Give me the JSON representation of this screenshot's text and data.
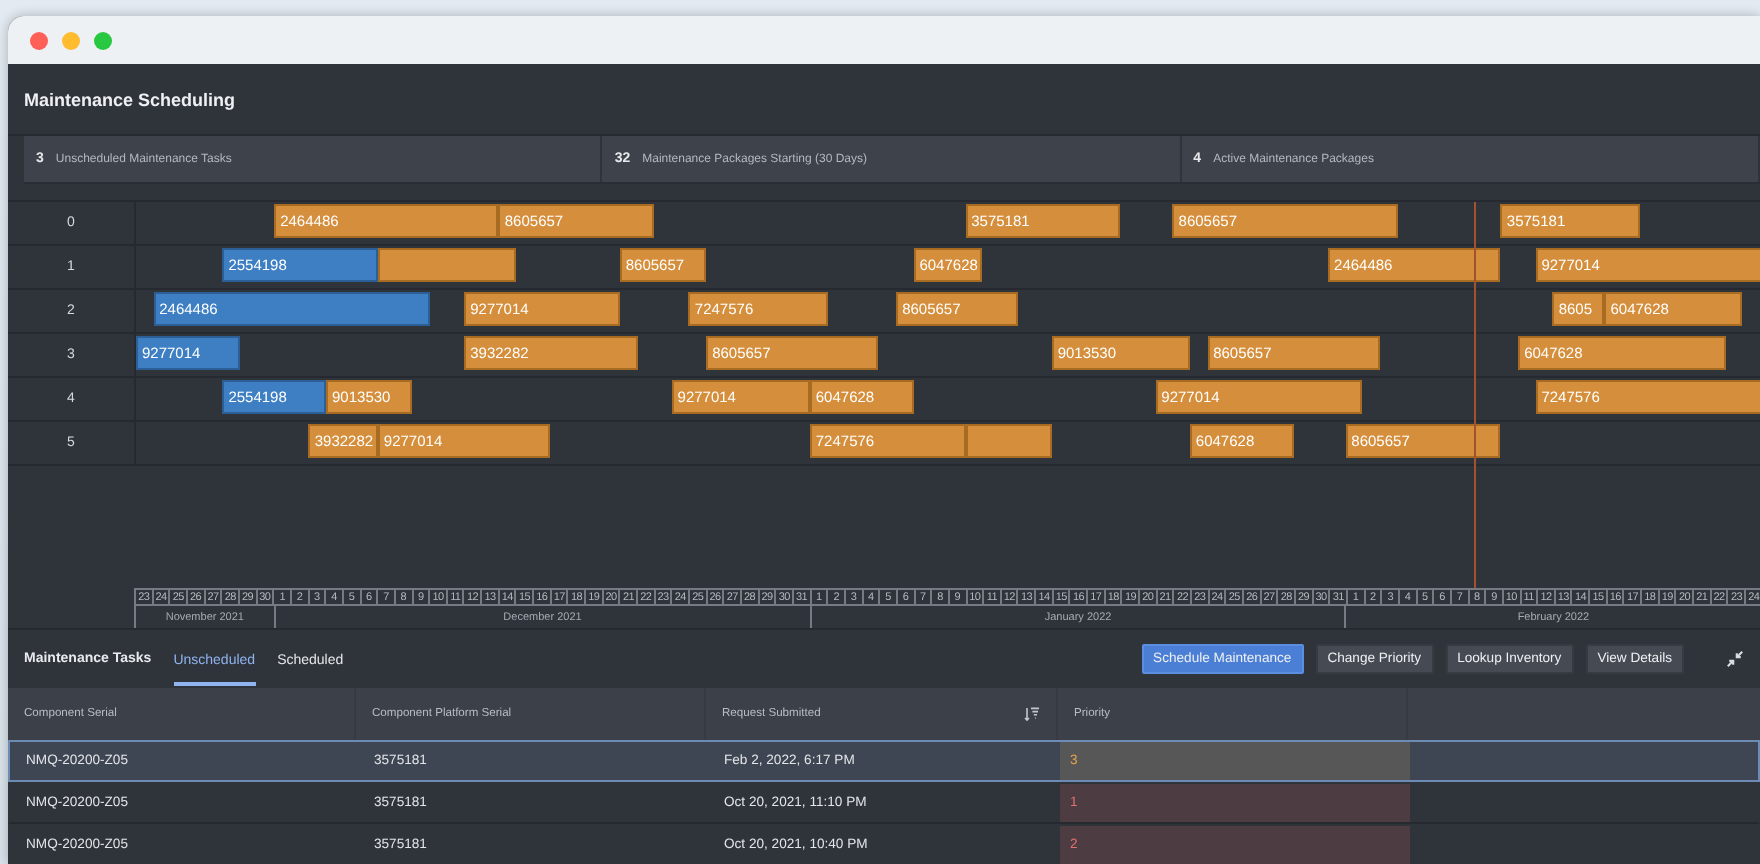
{
  "app": {
    "title": "Maintenance Scheduling"
  },
  "stats": [
    {
      "value": "3",
      "label": "Unscheduled Maintenance Tasks"
    },
    {
      "value": "32",
      "label": "Maintenance Packages Starting (30 Days)"
    },
    {
      "value": "4",
      "label": "Active Maintenance Packages"
    }
  ],
  "gantt": {
    "rows": [
      {
        "label": "0",
        "bars": [
          {
            "text": "2464486",
            "kind": "planned"
          },
          {
            "text": "8605657",
            "kind": "planned"
          },
          {
            "text": "3575181",
            "kind": "planned"
          },
          {
            "text": "8605657",
            "kind": "planned"
          },
          {
            "text": "3575181",
            "kind": "planned"
          }
        ]
      },
      {
        "label": "1",
        "bars": [
          {
            "text": "2554198",
            "kind": "active"
          },
          {
            "kind": "planned"
          },
          {
            "text": "8605657",
            "kind": "planned"
          },
          {
            "text": "6047628",
            "kind": "planned"
          },
          {
            "text": "2464486",
            "kind": "planned"
          },
          {
            "text": "9277014",
            "kind": "planned"
          }
        ]
      },
      {
        "label": "2",
        "bars": [
          {
            "text": "2464486",
            "kind": "active"
          },
          {
            "text": "9277014",
            "kind": "planned"
          },
          {
            "text": "7247576",
            "kind": "planned"
          },
          {
            "text": "8605657",
            "kind": "planned"
          },
          {
            "text": "8605",
            "kind": "planned"
          },
          {
            "text": "6047628",
            "kind": "planned"
          }
        ]
      },
      {
        "label": "3",
        "bars": [
          {
            "text": "9277014",
            "kind": "active"
          },
          {
            "text": "3932282",
            "kind": "planned"
          },
          {
            "text": "8605657",
            "kind": "planned"
          },
          {
            "text": "9013530",
            "kind": "planned"
          },
          {
            "text": "8605657",
            "kind": "planned"
          },
          {
            "text": "6047628",
            "kind": "planned"
          }
        ]
      },
      {
        "label": "4",
        "bars": [
          {
            "text": "2554198",
            "kind": "active"
          },
          {
            "text": "9013530",
            "kind": "planned"
          },
          {
            "text": "9277014",
            "kind": "planned"
          },
          {
            "text": "6047628",
            "kind": "planned"
          },
          {
            "text": "9277014",
            "kind": "planned"
          },
          {
            "text": "7247576",
            "kind": "planned"
          }
        ]
      },
      {
        "label": "5",
        "bars": [
          {
            "text": "3932282",
            "kind": "planned"
          },
          {
            "text": "9277014",
            "kind": "planned"
          },
          {
            "text": "7247576",
            "kind": "planned"
          },
          {
            "kind": "planned"
          },
          {
            "text": "6047628",
            "kind": "planned"
          },
          {
            "text": "8605657",
            "kind": "planned"
          }
        ]
      }
    ]
  },
  "timeline": {
    "months": [
      {
        "label": "November 2021",
        "days": [
          "23",
          "24",
          "25",
          "26",
          "27",
          "28",
          "29",
          "30"
        ]
      },
      {
        "label": "December 2021",
        "days": [
          "1",
          "2",
          "3",
          "4",
          "5",
          "6",
          "7",
          "8",
          "9",
          "10",
          "11",
          "12",
          "13",
          "14",
          "15",
          "16",
          "17",
          "18",
          "19",
          "20",
          "21",
          "22",
          "23",
          "24",
          "25",
          "26",
          "27",
          "28",
          "29",
          "30",
          "31"
        ]
      },
      {
        "label": "January 2022",
        "days": [
          "1",
          "2",
          "3",
          "4",
          "5",
          "6",
          "7",
          "8",
          "9",
          "10",
          "11",
          "12",
          "13",
          "14",
          "15",
          "16",
          "17",
          "18",
          "19",
          "20",
          "21",
          "22",
          "23",
          "24",
          "25",
          "26",
          "27",
          "28",
          "29",
          "30",
          "31"
        ]
      },
      {
        "label": "February 2022",
        "days": [
          "1",
          "2",
          "3",
          "4",
          "5",
          "6",
          "7",
          "8",
          "9",
          "10",
          "11",
          "12",
          "13",
          "14",
          "15",
          "16",
          "17",
          "18",
          "19",
          "20",
          "21",
          "22",
          "23",
          "24"
        ]
      }
    ]
  },
  "tasks": {
    "title": "Maintenance Tasks",
    "tabs": [
      {
        "label": "Unscheduled",
        "selected": true
      },
      {
        "label": "Scheduled",
        "selected": false
      }
    ],
    "actions": [
      {
        "label": "Schedule Maintenance",
        "primary": true
      },
      {
        "label": "Change Priority",
        "primary": false
      },
      {
        "label": "Lookup Inventory",
        "primary": false
      },
      {
        "label": "View Details",
        "primary": false
      }
    ],
    "columns": [
      {
        "label": "Component Serial",
        "sorted": false
      },
      {
        "label": "Component Platform Serial",
        "sorted": false
      },
      {
        "label": "Request Submitted",
        "sorted": true
      },
      {
        "label": "Priority",
        "sorted": false
      }
    ],
    "rows": [
      {
        "selected": true,
        "cells": [
          "NMQ-20200-Z05",
          "3575181",
          "Feb 2, 2022, 6:17 PM"
        ],
        "priority": "3",
        "color": "#575757"
      },
      {
        "selected": false,
        "cells": [
          "NMQ-20200-Z05",
          "3575181",
          "Oct 20, 2021, 11:10 PM"
        ],
        "priority": "1",
        "color": "#4d3c42"
      },
      {
        "selected": false,
        "cells": [
          "NMQ-20200-Z05",
          "3575181",
          "Oct 20, 2021, 10:40 PM"
        ],
        "priority": "2",
        "color": "#4d3c42"
      }
    ]
  }
}
